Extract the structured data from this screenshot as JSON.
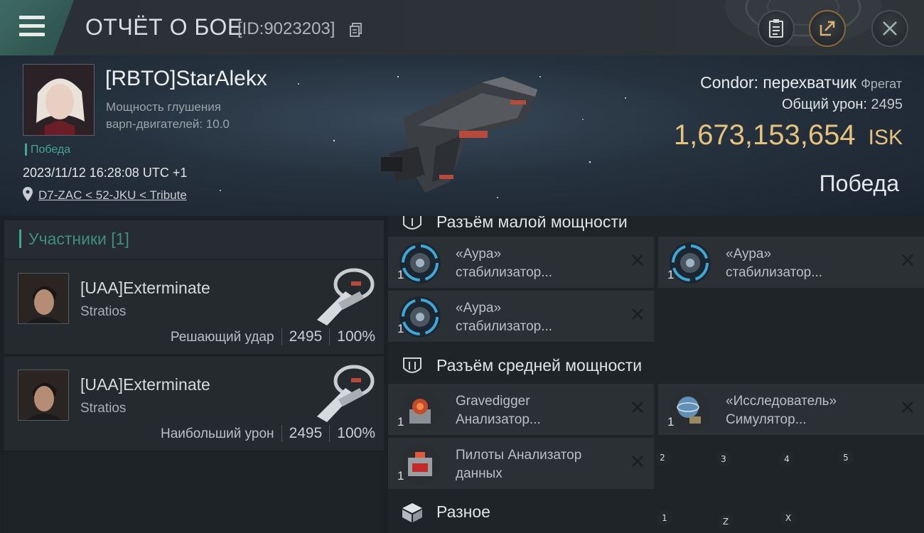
{
  "header": {
    "title": "ОТЧЁТ О БОЕ",
    "report_id": "[ID:9023203]"
  },
  "pilot": {
    "name": "[RBTO]StarAlekx",
    "attr_line1": "Мощность глушения",
    "attr_line2": "варп-двигателей: 10.0",
    "result_tag": "Победа",
    "timestamp": "2023/11/12 16:28:08 UTC +1",
    "location": "D7-ZAC < 52-JKU < Tribute"
  },
  "ship": {
    "name": "Condor: перехватчик",
    "class": "Фрегат",
    "damage_label": "Общий урон:",
    "damage_value": "2495",
    "isk_value": "1,673,153,654",
    "isk_unit": "ISK",
    "outcome": "Победа"
  },
  "participants": {
    "header": "Участники [1]",
    "items": [
      {
        "name": "[UAA]Exterminate",
        "ship": "Stratios",
        "role": "Решающий удар",
        "damage": "2495",
        "percent": "100%"
      },
      {
        "name": "[UAA]Exterminate",
        "ship": "Stratios",
        "role": "Наибольший урон",
        "damage": "2495",
        "percent": "100%"
      }
    ]
  },
  "fitting": {
    "low_slot": {
      "label": "Разъём малой мощности",
      "modules": [
        {
          "line1": "«Аура»",
          "line2": "стабилизатор...",
          "qty": "1"
        },
        {
          "line1": "«Аура»",
          "line2": "стабилизатор...",
          "qty": "1"
        },
        {
          "line1": "«Аура»",
          "line2": "стабилизатор...",
          "qty": "1"
        }
      ]
    },
    "mid_slot": {
      "label": "Разъём средней мощности",
      "modules": [
        {
          "line1": "Gravedigger",
          "line2": "Анализатор...",
          "qty": "1"
        },
        {
          "line1": "«Исследователь»",
          "line2": "Симулятор...",
          "qty": "1"
        },
        {
          "line1": "Пилоты Анализатор",
          "line2": "данных",
          "qty": "1"
        }
      ]
    },
    "misc": {
      "label": "Разное"
    }
  },
  "overlay_keys": [
    "2",
    "3",
    "4",
    "5",
    "1",
    "Z",
    "X"
  ],
  "colors": {
    "accent_teal": "#3fa88f",
    "isk_gold": "#e7c27a",
    "panel_bg": "#2b3035"
  },
  "icons": [
    "menu-icon",
    "copy-icon",
    "clipboard-icon",
    "share-icon",
    "close-icon",
    "location-pin-icon",
    "low-slot-icon",
    "mid-slot-icon",
    "cube-icon",
    "remove-icon"
  ]
}
